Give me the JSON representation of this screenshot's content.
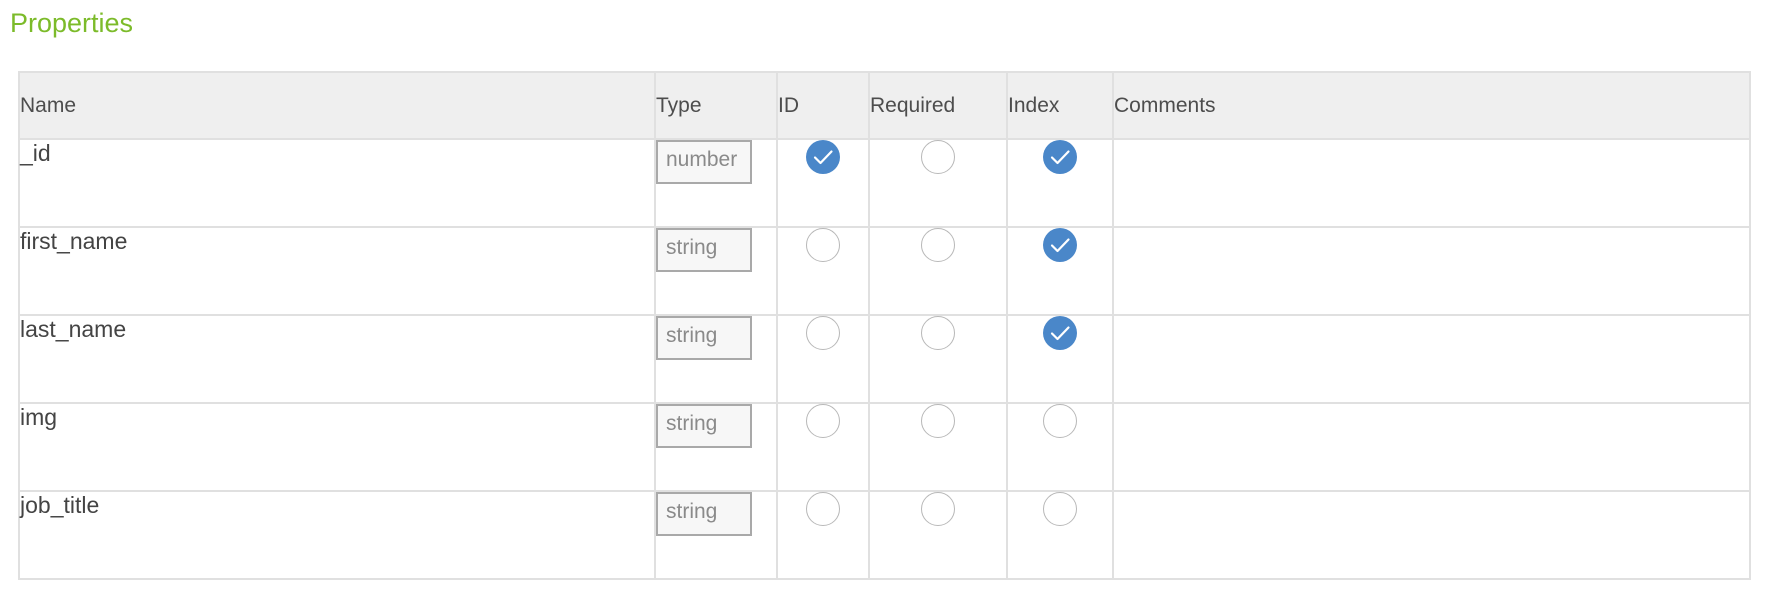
{
  "section": {
    "title": "Properties",
    "title_color": "#7cbb2a"
  },
  "table": {
    "headers": {
      "name": "Name",
      "type": "Type",
      "id": "ID",
      "required": "Required",
      "index": "Index",
      "comments": "Comments"
    },
    "rows": [
      {
        "name": "_id",
        "type": "number",
        "id": true,
        "required": false,
        "index": true,
        "comments": ""
      },
      {
        "name": "first_name",
        "type": "string",
        "id": false,
        "required": false,
        "index": true,
        "comments": ""
      },
      {
        "name": "last_name",
        "type": "string",
        "id": false,
        "required": false,
        "index": true,
        "comments": ""
      },
      {
        "name": "img",
        "type": "string",
        "id": false,
        "required": false,
        "index": false,
        "comments": ""
      },
      {
        "name": "job_title",
        "type": "string",
        "id": false,
        "required": false,
        "index": false,
        "comments": ""
      }
    ]
  },
  "colors": {
    "checked": "#4a87c9",
    "header_bg": "#efefef",
    "border": "#e0e0e0"
  },
  "icons": {
    "checked": "checkmark-circle-icon",
    "unchecked": "empty-circle-icon"
  }
}
